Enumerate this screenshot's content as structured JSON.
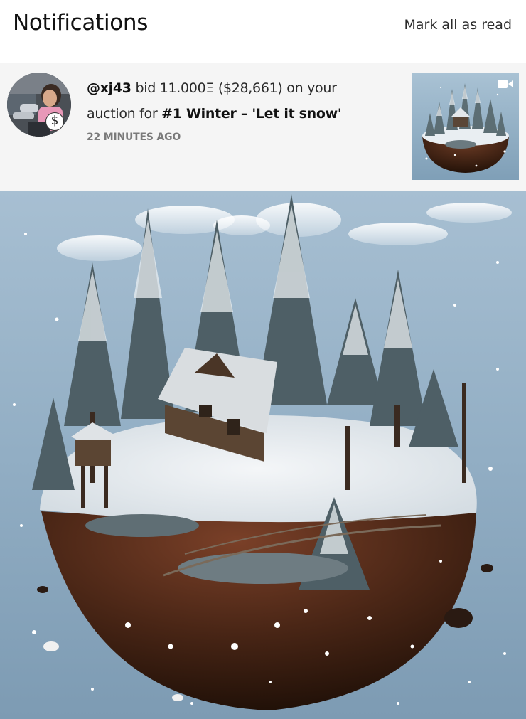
{
  "header": {
    "title": "Notifications",
    "mark_all_label": "Mark all as read"
  },
  "notification": {
    "user": "@xj43",
    "text_bid": " bid ",
    "amount": "11.000Ξ",
    "usd": " ($28,661)",
    "text_on": " on your auction for ",
    "artwork_title": "#1 Winter – 'Let it snow'",
    "time": "22 MINUTES AGO",
    "badge_icon": "dollar-icon",
    "thumbnail_icon": "video-camera-icon"
  },
  "colors": {
    "notification_bg": "#f5f5f5",
    "time_text": "#7a7a7a",
    "sky": "#9fbad0"
  }
}
